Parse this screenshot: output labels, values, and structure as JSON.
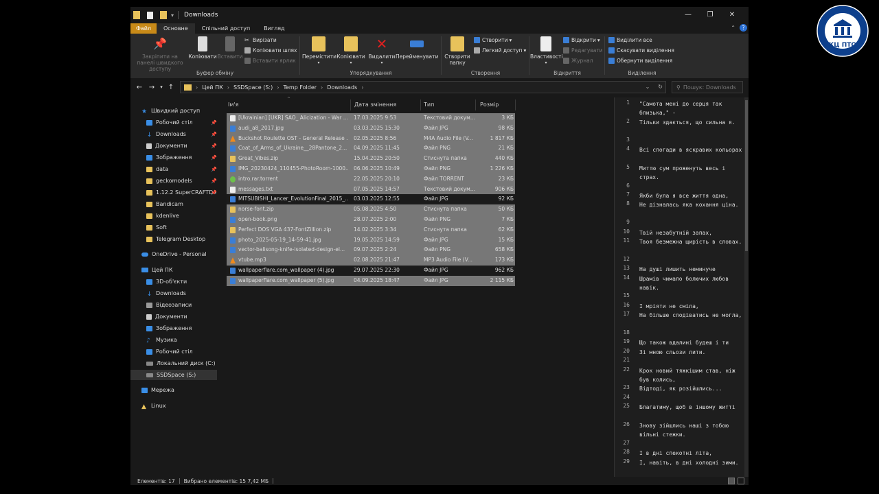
{
  "window": {
    "title": "Downloads",
    "controls": {
      "minimize": "—",
      "maximize": "❐",
      "close": "✕"
    }
  },
  "ribbon_tabs": [
    "Файл",
    "Основне",
    "Спільний доступ",
    "Вигляд"
  ],
  "ribbon": {
    "clipboard": {
      "label": "Буфер обміну",
      "pin": "Закріпити на панелі швидкого доступу",
      "copy": "Копіювати",
      "paste": "Вставити",
      "cut": "Вирізати",
      "copy_path": "Копіювати шлях",
      "paste_shortcut": "Вставити ярлик"
    },
    "organize": {
      "label": "Упорядкування",
      "move": "Перемістити",
      "copy_to": "Копіювати",
      "delete": "Видалити",
      "rename": "Перейменувати"
    },
    "new": {
      "label": "Створення",
      "new_folder": "Створити папку",
      "new_item": "Створити",
      "easy_access": "Легкий доступ"
    },
    "open": {
      "label": "Відкриття",
      "properties": "Властивості",
      "open": "Відкрити",
      "edit": "Редагувати",
      "history": "Журнал"
    },
    "select": {
      "label": "Виділення",
      "select_all": "Виділити все",
      "select_none": "Скасувати виділення",
      "invert": "Обернути виділення"
    }
  },
  "address": {
    "crumbs": [
      "Цей ПК",
      "SSDSpace (S:)",
      "Temp Folder",
      "Downloads"
    ],
    "search_placeholder": "Пошук: Downloads"
  },
  "nav": {
    "quick_access": "Швидкий доступ",
    "quick_items": [
      {
        "label": "Робочий стіл",
        "pinned": true
      },
      {
        "label": "Downloads",
        "pinned": true
      },
      {
        "label": "Документи",
        "pinned": true
      },
      {
        "label": "Зображення",
        "pinned": true
      },
      {
        "label": "data",
        "pinned": true
      },
      {
        "label": "geckomodels",
        "pinned": true
      },
      {
        "label": "1.12.2 SuperCRAFTDe",
        "pinned": true
      },
      {
        "label": "Bandicam",
        "pinned": false
      },
      {
        "label": "kdenlive",
        "pinned": false
      },
      {
        "label": "Soft",
        "pinned": false
      },
      {
        "label": "Telegram Desktop",
        "pinned": false
      }
    ],
    "onedrive": "OneDrive - Personal",
    "this_pc": "Цей ПК",
    "pc_items": [
      "3D-об'єкти",
      "Downloads",
      "Відеозаписи",
      "Документи",
      "Зображення",
      "Музика",
      "Робочий стіл",
      "Локальний диск (C:)",
      "SSDSpace (S:)"
    ],
    "network": "Мережа",
    "linux": "Linux"
  },
  "columns": {
    "name": "Ім'я",
    "date": "Дата змінення",
    "type": "Тип",
    "size": "Розмір"
  },
  "files": [
    {
      "name": "[Ukrainian] [UKR] SAO_ Alicization - War ...",
      "date": "17.03.2025 9:53",
      "type": "Текстовий докум...",
      "size": "3 КБ",
      "icon": "doc",
      "selected": true
    },
    {
      "name": "audi_a8_2017.jpg",
      "date": "03.03.2025 15:30",
      "type": "Файл JPG",
      "size": "98 КБ",
      "icon": "img",
      "selected": true
    },
    {
      "name": "Buckshot Roulette OST - General Release ...",
      "date": "02.05.2025 8:56",
      "type": "M4A Audio File (V...",
      "size": "1 817 КБ",
      "icon": "vlc",
      "selected": true
    },
    {
      "name": "Coat_of_Arms_of_Ukraine__28Pantone_2...",
      "date": "04.09.2025 11:45",
      "type": "Файл PNG",
      "size": "21 КБ",
      "icon": "img",
      "selected": true
    },
    {
      "name": "Great_Vibes.zip",
      "date": "15.04.2025 20:50",
      "type": "Стиснута папка",
      "size": "440 КБ",
      "icon": "zip",
      "selected": true
    },
    {
      "name": "IMG_20230424_110455-PhotoRoom-1000...",
      "date": "06.06.2025 10:49",
      "type": "Файл PNG",
      "size": "1 226 КБ",
      "icon": "img",
      "selected": true
    },
    {
      "name": "intro.rar.torrent",
      "date": "22.05.2025 20:10",
      "type": "Файл TORRENT",
      "size": "23 КБ",
      "icon": "tor",
      "selected": true
    },
    {
      "name": "messages.txt",
      "date": "07.05.2025 14:57",
      "type": "Текстовий докум...",
      "size": "906 КБ",
      "icon": "doc",
      "selected": true
    },
    {
      "name": "MITSUBISHI_Lancer_EvolutionFinal_2015_...",
      "date": "03.03.2025 12:55",
      "type": "Файл JPG",
      "size": "92 КБ",
      "icon": "img",
      "selected": false
    },
    {
      "name": "norse-font.zip",
      "date": "05.08.2025 4:50",
      "type": "Стиснута папка",
      "size": "50 КБ",
      "icon": "zip",
      "selected": true
    },
    {
      "name": "open-book.png",
      "date": "28.07.2025 2:00",
      "type": "Файл PNG",
      "size": "7 КБ",
      "icon": "img",
      "selected": true
    },
    {
      "name": "Perfect DOS VGA 437-FontZillion.zip",
      "date": "14.02.2025 3:34",
      "type": "Стиснута папка",
      "size": "62 КБ",
      "icon": "zip",
      "selected": true
    },
    {
      "name": "photo_2025-05-19_14-59-41.jpg",
      "date": "19.05.2025 14:59",
      "type": "Файл JPG",
      "size": "15 КБ",
      "icon": "img",
      "selected": true
    },
    {
      "name": "vector-balisong-knife-isolated-design-el...",
      "date": "09.07.2025 2:24",
      "type": "Файл PNG",
      "size": "658 КБ",
      "icon": "img",
      "selected": true
    },
    {
      "name": "vtube.mp3",
      "date": "02.08.2025 21:47",
      "type": "MP3 Audio File (V...",
      "size": "173 КБ",
      "icon": "vlc",
      "selected": true
    },
    {
      "name": "wallpaperflare.com_wallpaper (4).jpg",
      "date": "29.07.2025 22:30",
      "type": "Файл JPG",
      "size": "962 КБ",
      "icon": "img",
      "selected": false
    },
    {
      "name": "wallpaperflare.com_wallpaper (5).jpg",
      "date": "04.09.2025 18:47",
      "type": "Файл JPG",
      "size": "2 115 КБ",
      "icon": "img",
      "selected": true
    }
  ],
  "preview": [
    {
      "n": "1",
      "text": "\"Самота мені до серця так близька,\" -"
    },
    {
      "n": "2",
      "text": "Тільки здається, що сильна я."
    },
    {
      "n": "3",
      "text": ""
    },
    {
      "n": "4",
      "text": "Всі спогади в яскравих кольорах"
    },
    {
      "n": "5",
      "text": "Миттю сум проженуть весь і страх."
    },
    {
      "n": "6",
      "text": ""
    },
    {
      "n": "7",
      "text": "Якби була я все життя одна,"
    },
    {
      "n": "8",
      "text": "Не дізналась яка  кохання ціна."
    },
    {
      "n": "9",
      "text": ""
    },
    {
      "n": "10",
      "text": "Твій незабутній запах,"
    },
    {
      "n": "11",
      "text": "Твоя безмежна щирість в словах."
    },
    {
      "n": "12",
      "text": ""
    },
    {
      "n": "13",
      "text": "На душі лишить неминуче"
    },
    {
      "n": "14",
      "text": "Шрамів чимало болючих любов навік."
    },
    {
      "n": "15",
      "text": ""
    },
    {
      "n": "16",
      "text": "І мріяти не сміла,"
    },
    {
      "n": "17",
      "text": "На більше сподіватись не могла,"
    },
    {
      "n": "18",
      "text": ""
    },
    {
      "n": "19",
      "text": "Що також вдалині будеш і ти"
    },
    {
      "n": "20",
      "text": "Зі мною сльози лити."
    },
    {
      "n": "21",
      "text": ""
    },
    {
      "n": "22",
      "text": "Крок новий тяжкішим став, ніж був колись,"
    },
    {
      "n": "23",
      "text": "Відтоді, як розійшлись..."
    },
    {
      "n": "24",
      "text": ""
    },
    {
      "n": "25",
      "text": "Благатиму, щоб в іншому житті"
    },
    {
      "n": "26",
      "text": "Знову зійшлись наші з тобою вільні стежки."
    },
    {
      "n": "27",
      "text": ""
    },
    {
      "n": "28",
      "text": "І в дні спекотні літа,"
    },
    {
      "n": "29",
      "text": "І, навіть, в дні холодні зими."
    }
  ],
  "status": {
    "items": "Елементів: 17",
    "selected": "Вибрано елементів: 15  7,42 МБ"
  },
  "logo": {
    "text": "КЦ ПТО"
  }
}
